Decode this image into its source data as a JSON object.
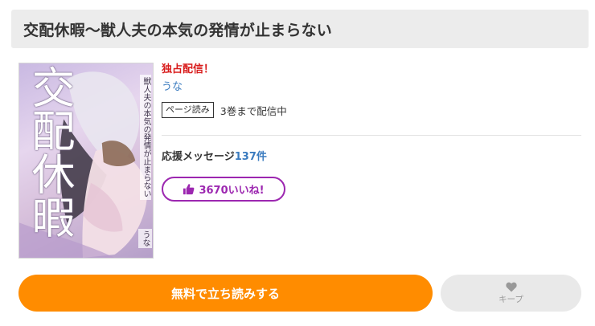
{
  "title": "交配休暇〜獣人夫の本気の発情が止まらない",
  "cover": {
    "title_vertical": "交配休暇",
    "subtitle_vertical": "獣人夫の本気の発情が止まらない",
    "author_vertical": "うな",
    "colors": {
      "bg": "#c9b9e2",
      "accent": "#ffffff"
    }
  },
  "info": {
    "exclusive": "独占配信！",
    "author": "うな",
    "read_tag": "ページ読み",
    "read_status": "3巻まで配信中",
    "cheer_label": "応援メッセージ",
    "cheer_count": "137件",
    "like_label": "3670いいね!"
  },
  "actions": {
    "trial_label": "無料で立ち読みする",
    "keep_label": "キープ"
  },
  "colors": {
    "exclusive": "#d81b1b",
    "link": "#3a7bbf",
    "like": "#9c27b0",
    "primary": "#ff8c00",
    "secondary": "#e9e9e9"
  },
  "icons": {
    "like": "thumbs-up-icon",
    "keep": "heart-icon"
  }
}
